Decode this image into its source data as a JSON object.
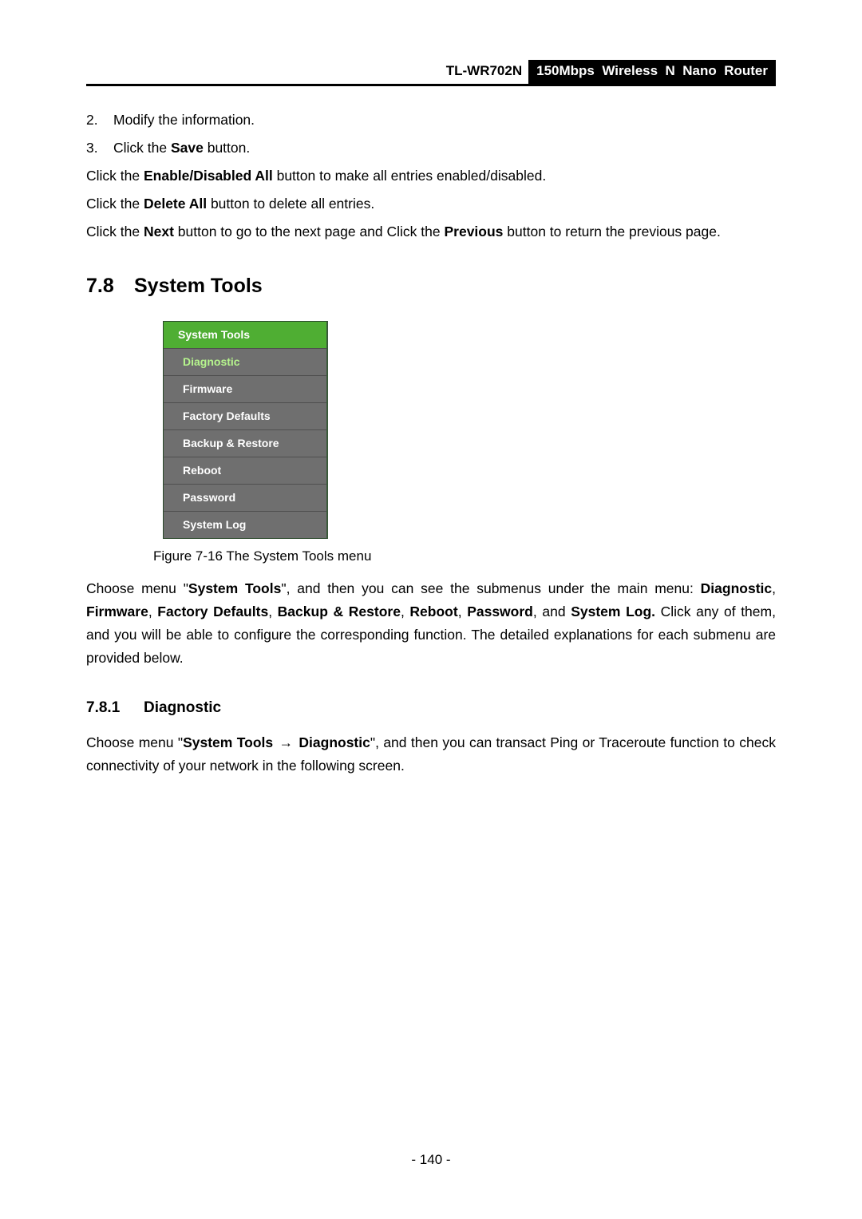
{
  "header": {
    "model": "TL-WR702N",
    "description": "150Mbps  Wireless  N  Nano  Router"
  },
  "steps": [
    {
      "num": "2.",
      "text": "Modify the information."
    },
    {
      "num": "3.",
      "pre": "Click the ",
      "bold": "Save",
      "post": " button."
    }
  ],
  "para_enable": {
    "pre": "Click the ",
    "bold": "Enable/Disabled All",
    "post": " button to make all entries enabled/disabled."
  },
  "para_delete": {
    "pre": "Click the ",
    "bold": "Delete All",
    "post": " button to delete all entries."
  },
  "para_nav": {
    "t1": "Click the ",
    "b1": "Next",
    "t2": " button to go to the next page and Click the ",
    "b2": "Previous",
    "t3": " button to return the previous page."
  },
  "section": {
    "num": "7.8",
    "title": "System Tools"
  },
  "menu": {
    "header": "System Tools",
    "items": [
      {
        "label": "Diagnostic",
        "active": true
      },
      {
        "label": "Firmware",
        "active": false
      },
      {
        "label": "Factory Defaults",
        "active": false
      },
      {
        "label": "Backup & Restore",
        "active": false
      },
      {
        "label": "Reboot",
        "active": false
      },
      {
        "label": "Password",
        "active": false
      },
      {
        "label": "System Log",
        "active": false
      }
    ]
  },
  "figure_caption": "Figure 7-16 The System Tools menu",
  "para_choose": {
    "t1": "Choose menu \"",
    "b1": "System Tools",
    "t2": "\", and then you can see the submenus under the main menu: ",
    "b2": "Diagnostic",
    "c1": ", ",
    "b3": "Firmware",
    "c2": ", ",
    "b4": "Factory Defaults",
    "c3": ", ",
    "b5": "Backup & Restore",
    "c4": ", ",
    "b6": "Reboot",
    "c5": ", ",
    "b7": "Password",
    "c6": ", and ",
    "b8": "System Log.",
    "t3": " Click any of them, and you will be able to configure the corresponding function. The detailed explanations for each submenu are provided below."
  },
  "subsection": {
    "num": "7.8.1",
    "title": "Diagnostic"
  },
  "para_diag": {
    "t1": "Choose menu \"",
    "b1": "System Tools",
    "arrow": "→",
    "b2": "Diagnostic",
    "t2": "\", and then you can transact Ping or Traceroute function to check connectivity of your network in the following screen."
  },
  "page_number": "- 140 -"
}
